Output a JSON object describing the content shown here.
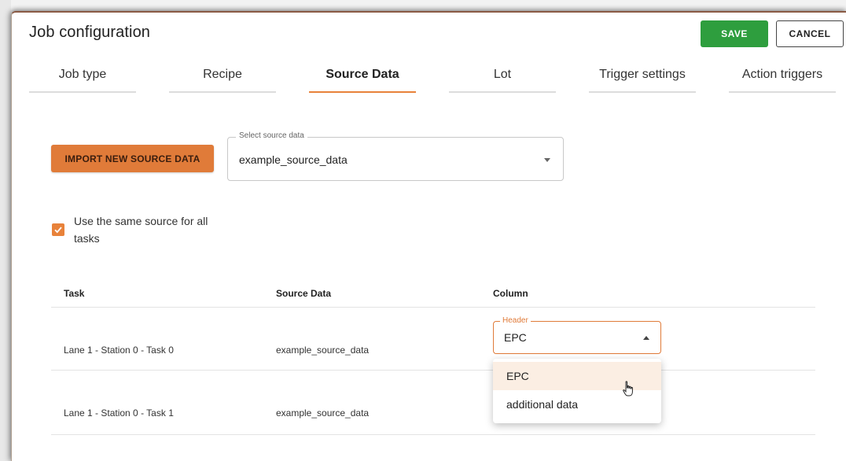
{
  "dialog": {
    "title": "Job configuration",
    "save_label": "SAVE",
    "cancel_label": "CANCEL"
  },
  "tabs": [
    {
      "label": "Job type",
      "active": false
    },
    {
      "label": "Recipe",
      "active": false
    },
    {
      "label": "Source Data",
      "active": true
    },
    {
      "label": "Lot",
      "active": false
    },
    {
      "label": "Trigger settings",
      "active": false
    },
    {
      "label": "Action triggers",
      "active": false
    }
  ],
  "source": {
    "import_label": "IMPORT NEW SOURCE DATA",
    "select_label": "Select source data",
    "select_value": "example_source_data",
    "same_source_label": "Use the same source for all tasks",
    "same_source_checked": true
  },
  "table": {
    "columns": [
      "Task",
      "Source Data",
      "Column"
    ],
    "rows": [
      {
        "task": "Lane 1 - Station 0 - Task 0",
        "source": "example_source_data",
        "column_label": "Header",
        "column_value": "EPC"
      },
      {
        "task": "Lane 1 - Station 0 - Task 1",
        "source": "example_source_data",
        "column_label": "",
        "column_value": ""
      }
    ]
  },
  "dropdown": {
    "options": [
      "EPC",
      "additional data"
    ],
    "highlighted": "EPC"
  },
  "colors": {
    "accent": "#e07b39",
    "save": "#2e9e3e",
    "option_hover": "#fbeee3"
  },
  "icons": [
    "chevron-down-icon",
    "chevron-up-icon",
    "check-icon",
    "hand-pointer-cursor"
  ]
}
